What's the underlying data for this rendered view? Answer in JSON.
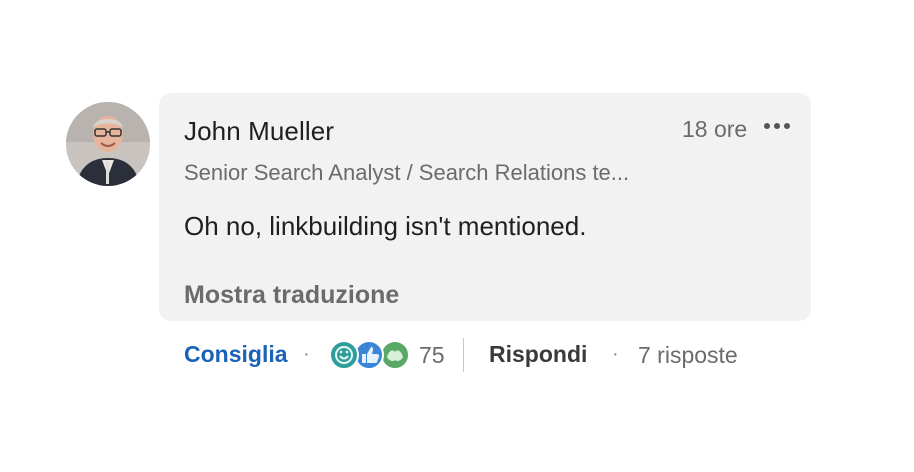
{
  "comment": {
    "author_name": "John Mueller",
    "timestamp": "18 ore",
    "author_headline": "Senior Search Analyst / Search Relations te...",
    "text": "Oh no, linkbuilding isn't mentioned.",
    "translate_label": "Mostra traduzione"
  },
  "actions": {
    "like_label": "Consiglia",
    "separator": "·",
    "reaction_count": "75",
    "reply_label": "Rispondi",
    "replies_label": "7 risposte"
  },
  "reactions": [
    "celebrate-icon",
    "like-icon",
    "support-icon"
  ],
  "colors": {
    "like_blue": "#1b62b8",
    "bubble_bg": "#f2f2f2",
    "secondary_text": "#6b6b6b"
  }
}
